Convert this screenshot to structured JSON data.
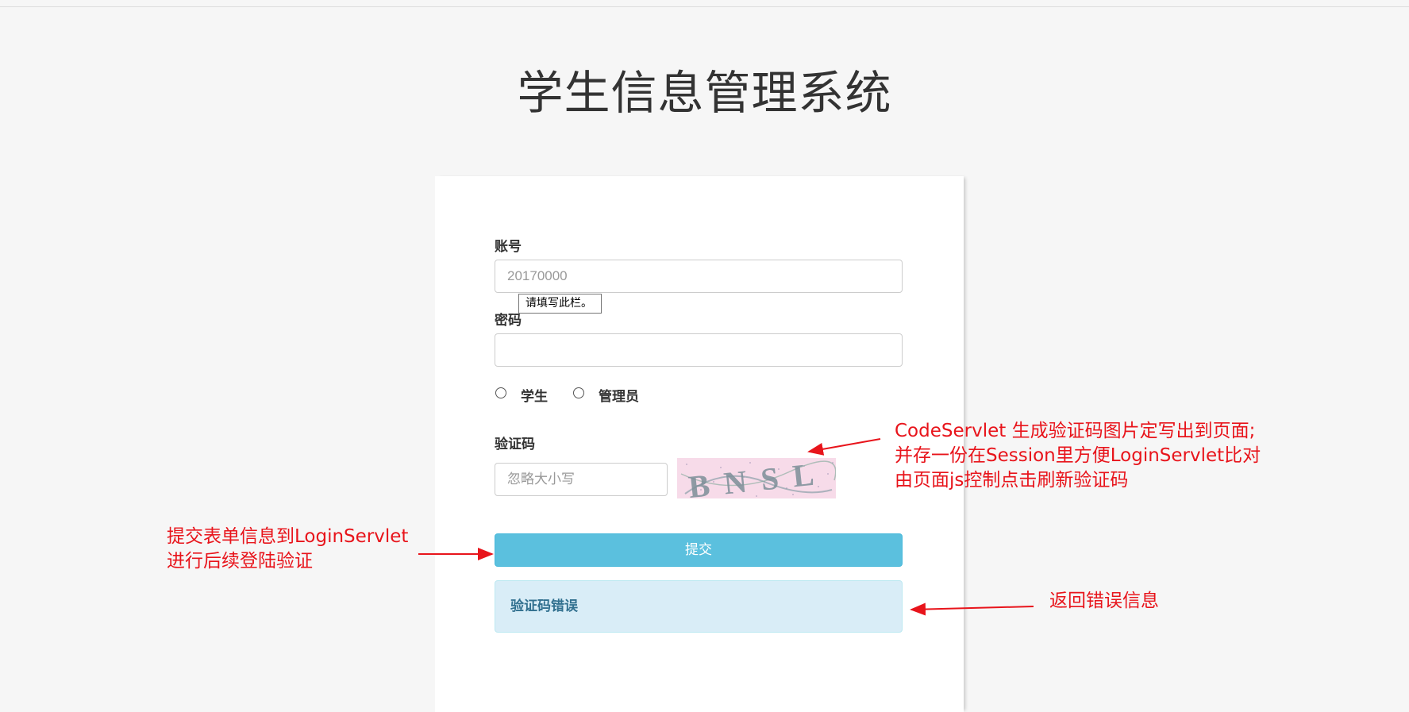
{
  "page": {
    "title": "学生信息管理系统"
  },
  "form": {
    "account_label": "账号",
    "account_placeholder": "20170000",
    "validation_tooltip": "请填写此栏。",
    "password_label": "密码",
    "password_value": "",
    "roles": [
      {
        "label": "学生",
        "checked": false
      },
      {
        "label": "管理员",
        "checked": false
      }
    ],
    "captcha_label": "验证码",
    "captcha_placeholder": "忽略大小写",
    "captcha_image_text": "BNSL",
    "submit_label": "提交",
    "error_message": "验证码错误"
  },
  "annotations": {
    "captcha_note": [
      "CodeServlet 生成验证码图片定写出到页面;",
      "并存一份在Session里方便LoginServlet比对",
      "由页面js控制点击刷新验证码"
    ],
    "submit_note": [
      "提交表单信息到LoginServlet",
      "进行后续登陆验证"
    ],
    "error_note": "返回错误信息"
  },
  "colors": {
    "background": "#f6f6f6",
    "submit_button": "#5bc0de",
    "alert_background": "#d9edf7",
    "alert_text": "#31708f",
    "annotation": "#e8141b",
    "captcha_background": "#f7dbe9"
  },
  "icons": {
    "radio": "radio-circle-icon",
    "arrow": "arrow-left-icon"
  }
}
